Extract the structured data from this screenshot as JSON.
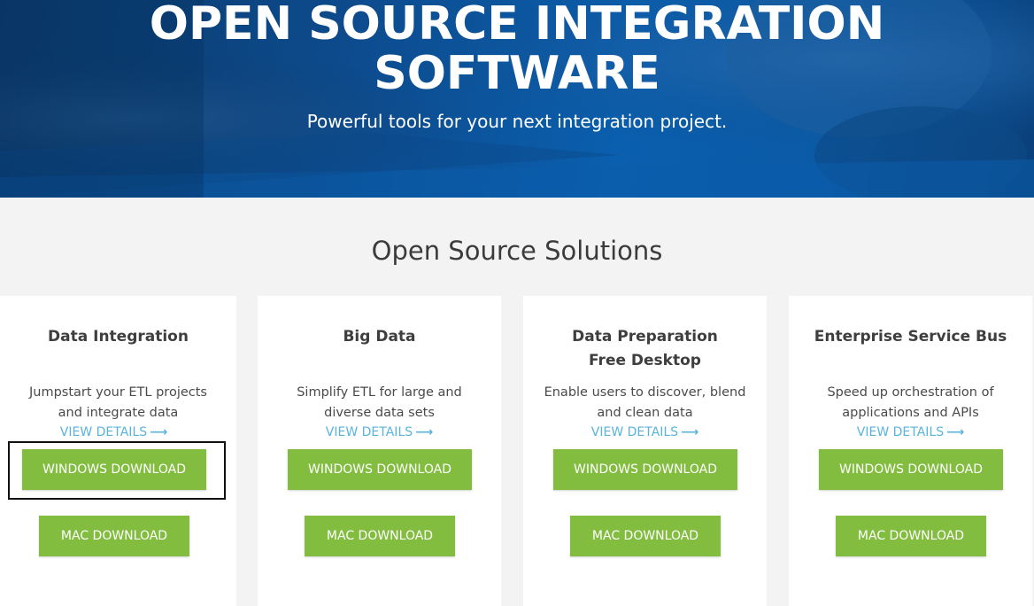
{
  "hero": {
    "title_line1": "OPEN SOURCE INTEGRATION",
    "title_line2": "SOFTWARE",
    "subtitle": "Powerful tools for your next integration project."
  },
  "section": {
    "title": "Open Source Solutions"
  },
  "cards": [
    {
      "title": "Data Integration",
      "description": "Jumpstart your ETL projects and integrate data",
      "view_details": "VIEW DETAILS",
      "windows_download": "WINDOWS DOWNLOAD",
      "mac_download": "MAC DOWNLOAD"
    },
    {
      "title": "Big Data",
      "description": "Simplify ETL for large and diverse data sets",
      "view_details": "VIEW DETAILS",
      "windows_download": "WINDOWS DOWNLOAD",
      "mac_download": "MAC DOWNLOAD"
    },
    {
      "title": "Data Preparation Free Desktop",
      "description": "Enable users to discover, blend and clean data",
      "view_details": "VIEW DETAILS",
      "windows_download": "WINDOWS DOWNLOAD",
      "mac_download": "MAC DOWNLOAD"
    },
    {
      "title": "Enterprise Service Bus",
      "description": "Speed up orchestration of applications and APIs",
      "view_details": "VIEW DETAILS",
      "windows_download": "WINDOWS DOWNLOAD",
      "mac_download": "MAC DOWNLOAD"
    }
  ],
  "icons": {
    "view_details_arrow": "arrow-right-icon"
  },
  "colors": {
    "hero_blue": "#0d4c8f",
    "button_green": "#82bd3f",
    "link_blue": "#5ab3de",
    "card_bg": "#ffffff",
    "page_bg": "#f3f3f3"
  }
}
